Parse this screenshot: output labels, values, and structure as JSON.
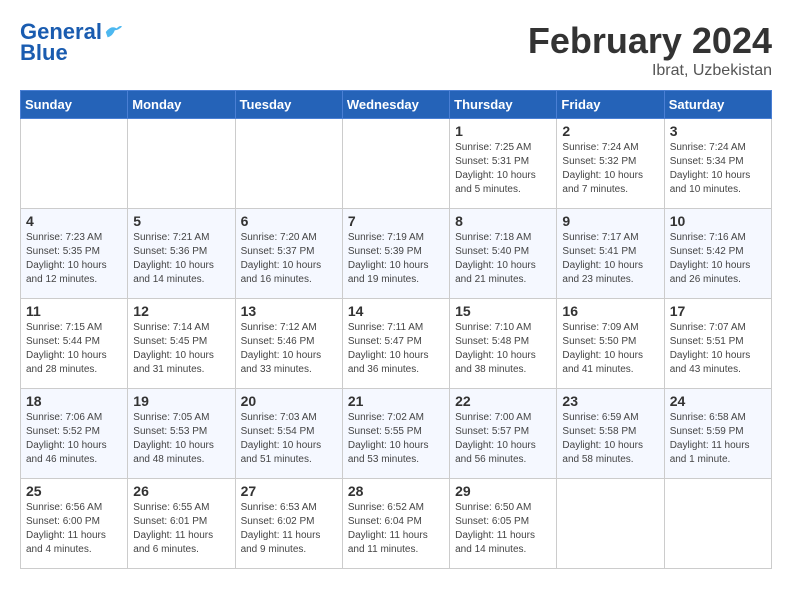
{
  "header": {
    "logo_line1": "General",
    "logo_line2": "Blue",
    "title": "February 2024",
    "location": "Ibrat, Uzbekistan"
  },
  "days_of_week": [
    "Sunday",
    "Monday",
    "Tuesday",
    "Wednesday",
    "Thursday",
    "Friday",
    "Saturday"
  ],
  "weeks": [
    [
      {
        "day": "",
        "info": ""
      },
      {
        "day": "",
        "info": ""
      },
      {
        "day": "",
        "info": ""
      },
      {
        "day": "",
        "info": ""
      },
      {
        "day": "1",
        "info": "Sunrise: 7:25 AM\nSunset: 5:31 PM\nDaylight: 10 hours\nand 5 minutes."
      },
      {
        "day": "2",
        "info": "Sunrise: 7:24 AM\nSunset: 5:32 PM\nDaylight: 10 hours\nand 7 minutes."
      },
      {
        "day": "3",
        "info": "Sunrise: 7:24 AM\nSunset: 5:34 PM\nDaylight: 10 hours\nand 10 minutes."
      }
    ],
    [
      {
        "day": "4",
        "info": "Sunrise: 7:23 AM\nSunset: 5:35 PM\nDaylight: 10 hours\nand 12 minutes."
      },
      {
        "day": "5",
        "info": "Sunrise: 7:21 AM\nSunset: 5:36 PM\nDaylight: 10 hours\nand 14 minutes."
      },
      {
        "day": "6",
        "info": "Sunrise: 7:20 AM\nSunset: 5:37 PM\nDaylight: 10 hours\nand 16 minutes."
      },
      {
        "day": "7",
        "info": "Sunrise: 7:19 AM\nSunset: 5:39 PM\nDaylight: 10 hours\nand 19 minutes."
      },
      {
        "day": "8",
        "info": "Sunrise: 7:18 AM\nSunset: 5:40 PM\nDaylight: 10 hours\nand 21 minutes."
      },
      {
        "day": "9",
        "info": "Sunrise: 7:17 AM\nSunset: 5:41 PM\nDaylight: 10 hours\nand 23 minutes."
      },
      {
        "day": "10",
        "info": "Sunrise: 7:16 AM\nSunset: 5:42 PM\nDaylight: 10 hours\nand 26 minutes."
      }
    ],
    [
      {
        "day": "11",
        "info": "Sunrise: 7:15 AM\nSunset: 5:44 PM\nDaylight: 10 hours\nand 28 minutes."
      },
      {
        "day": "12",
        "info": "Sunrise: 7:14 AM\nSunset: 5:45 PM\nDaylight: 10 hours\nand 31 minutes."
      },
      {
        "day": "13",
        "info": "Sunrise: 7:12 AM\nSunset: 5:46 PM\nDaylight: 10 hours\nand 33 minutes."
      },
      {
        "day": "14",
        "info": "Sunrise: 7:11 AM\nSunset: 5:47 PM\nDaylight: 10 hours\nand 36 minutes."
      },
      {
        "day": "15",
        "info": "Sunrise: 7:10 AM\nSunset: 5:48 PM\nDaylight: 10 hours\nand 38 minutes."
      },
      {
        "day": "16",
        "info": "Sunrise: 7:09 AM\nSunset: 5:50 PM\nDaylight: 10 hours\nand 41 minutes."
      },
      {
        "day": "17",
        "info": "Sunrise: 7:07 AM\nSunset: 5:51 PM\nDaylight: 10 hours\nand 43 minutes."
      }
    ],
    [
      {
        "day": "18",
        "info": "Sunrise: 7:06 AM\nSunset: 5:52 PM\nDaylight: 10 hours\nand 46 minutes."
      },
      {
        "day": "19",
        "info": "Sunrise: 7:05 AM\nSunset: 5:53 PM\nDaylight: 10 hours\nand 48 minutes."
      },
      {
        "day": "20",
        "info": "Sunrise: 7:03 AM\nSunset: 5:54 PM\nDaylight: 10 hours\nand 51 minutes."
      },
      {
        "day": "21",
        "info": "Sunrise: 7:02 AM\nSunset: 5:55 PM\nDaylight: 10 hours\nand 53 minutes."
      },
      {
        "day": "22",
        "info": "Sunrise: 7:00 AM\nSunset: 5:57 PM\nDaylight: 10 hours\nand 56 minutes."
      },
      {
        "day": "23",
        "info": "Sunrise: 6:59 AM\nSunset: 5:58 PM\nDaylight: 10 hours\nand 58 minutes."
      },
      {
        "day": "24",
        "info": "Sunrise: 6:58 AM\nSunset: 5:59 PM\nDaylight: 11 hours\nand 1 minute."
      }
    ],
    [
      {
        "day": "25",
        "info": "Sunrise: 6:56 AM\nSunset: 6:00 PM\nDaylight: 11 hours\nand 4 minutes."
      },
      {
        "day": "26",
        "info": "Sunrise: 6:55 AM\nSunset: 6:01 PM\nDaylight: 11 hours\nand 6 minutes."
      },
      {
        "day": "27",
        "info": "Sunrise: 6:53 AM\nSunset: 6:02 PM\nDaylight: 11 hours\nand 9 minutes."
      },
      {
        "day": "28",
        "info": "Sunrise: 6:52 AM\nSunset: 6:04 PM\nDaylight: 11 hours\nand 11 minutes."
      },
      {
        "day": "29",
        "info": "Sunrise: 6:50 AM\nSunset: 6:05 PM\nDaylight: 11 hours\nand 14 minutes."
      },
      {
        "day": "",
        "info": ""
      },
      {
        "day": "",
        "info": ""
      }
    ]
  ]
}
